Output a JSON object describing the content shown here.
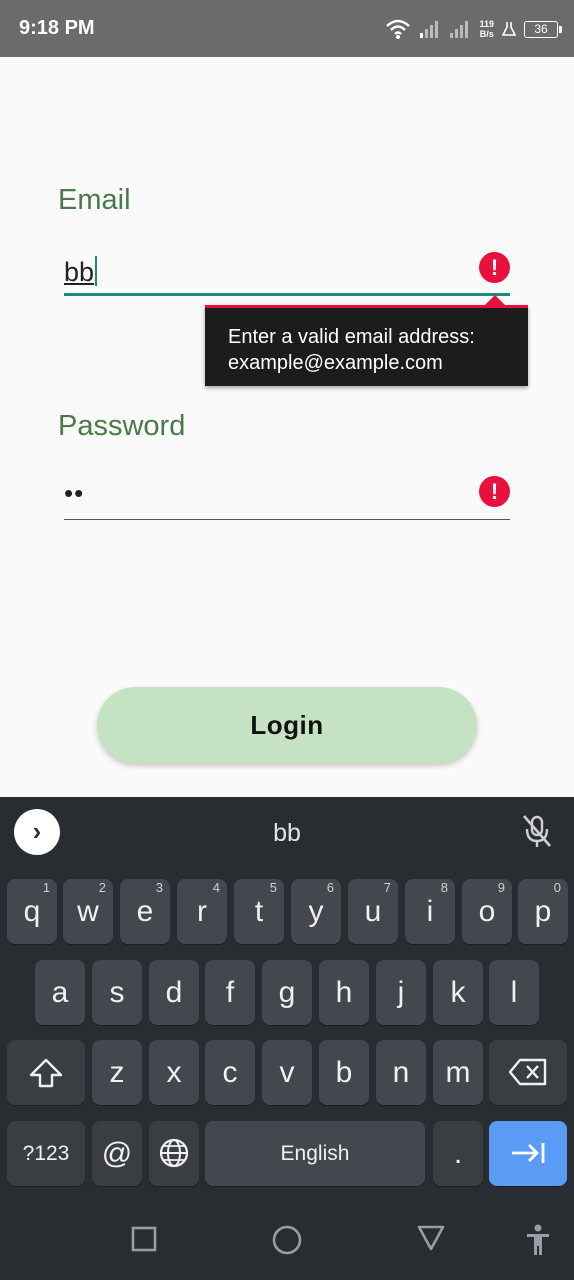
{
  "status_bar": {
    "time": "9:18 PM",
    "speed_value": "119",
    "speed_unit": "B/s",
    "battery": "36"
  },
  "form": {
    "email_label": "Email",
    "email_value": "bb",
    "email_error": "Enter a valid email address: example@example.com",
    "email_error_line1": "Enter a valid email address:",
    "email_error_line2": "example@example.com",
    "password_label": "Password",
    "password_value": "••",
    "error_glyph": "!",
    "login_label": "Login",
    "colors": {
      "label": "#4a7a4a",
      "accent": "#1e8a7a",
      "error": "#e8113e",
      "button": "#c5e3c3"
    }
  },
  "keyboard": {
    "suggestion": "bb",
    "expand_glyph": "›",
    "row1": [
      {
        "key": "q",
        "hint": "1"
      },
      {
        "key": "w",
        "hint": "2"
      },
      {
        "key": "e",
        "hint": "3"
      },
      {
        "key": "r",
        "hint": "4"
      },
      {
        "key": "t",
        "hint": "5"
      },
      {
        "key": "y",
        "hint": "6"
      },
      {
        "key": "u",
        "hint": "7"
      },
      {
        "key": "i",
        "hint": "8"
      },
      {
        "key": "o",
        "hint": "9"
      },
      {
        "key": "p",
        "hint": "0"
      }
    ],
    "row2": [
      "a",
      "s",
      "d",
      "f",
      "g",
      "h",
      "j",
      "k",
      "l"
    ],
    "row3": [
      "z",
      "x",
      "c",
      "v",
      "b",
      "n",
      "m"
    ],
    "symbols_label": "?123",
    "at_label": "@",
    "space_label": "English",
    "period_label": ".",
    "icons": {
      "shift": "shift-icon",
      "backspace": "backspace-icon",
      "globe": "globe-icon",
      "next": "next-field-icon",
      "mic": "mic-off-icon"
    },
    "colors": {
      "background": "#292c31",
      "key": "#44474d",
      "action": "#5a9cf5"
    }
  },
  "nav_bar": {
    "icons": [
      "recent-apps-icon",
      "home-icon",
      "back-icon",
      "accessibility-icon"
    ]
  }
}
